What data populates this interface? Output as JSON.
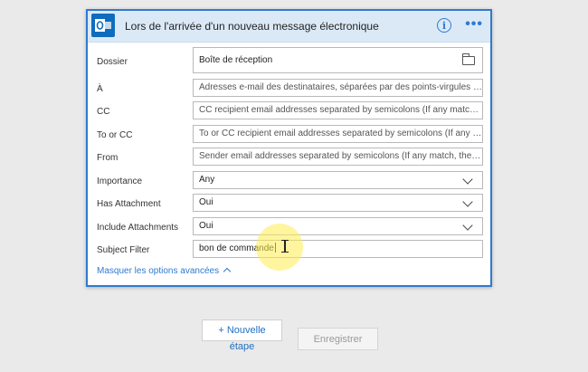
{
  "card": {
    "title": "Lors de l'arrivée d'un nouveau message électronique",
    "app_icon_text": "O",
    "info_icon": "i",
    "more_icon": "•••",
    "accent": "#2f7ad1",
    "header_bg": "#dbe9f7"
  },
  "rows": {
    "folder": {
      "label": "Dossier",
      "value": "Boîte de réception",
      "icon": "folder-icon"
    },
    "to": {
      "label": "À",
      "placeholder": "Adresses e-mail des destinataires, séparées par des points-virgules (si une de..."
    },
    "cc": {
      "label": "CC",
      "placeholder": "CC recipient email addresses separated by semicolons (If any match, the trigg..."
    },
    "to_or_cc": {
      "label": "To or CC",
      "placeholder": "To or CC recipient email addresses separated by semicolons (If any match, th..."
    },
    "from": {
      "label": "From",
      "placeholder": "Sender email addresses separated by semicolons (If any match, the trigger w..."
    },
    "importance": {
      "label": "Importance",
      "value": "Any"
    },
    "has_attachment": {
      "label": "Has Attachment",
      "value": "Oui"
    },
    "include_attachments": {
      "label": "Include Attachments",
      "value": "Oui"
    },
    "subject_filter": {
      "label": "Subject Filter",
      "value": "bon de commande"
    }
  },
  "advanced_link": "Masquer les options avancées",
  "buttons": {
    "new_step_line1": "+ Nouvelle",
    "new_step_line2": "étape",
    "save": "Enregistrer"
  }
}
